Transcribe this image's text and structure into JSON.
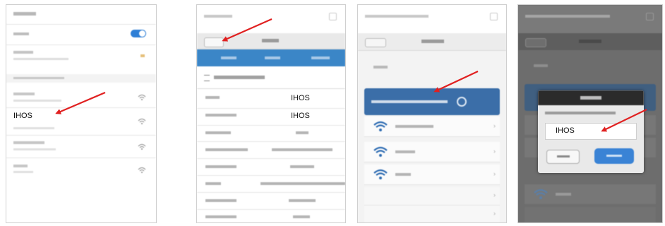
{
  "screen1": {
    "label": "IHOS"
  },
  "screen2": {
    "name_value": "IHOS",
    "device_name_value": "IHOS"
  },
  "screen4": {
    "input_value": "IHOS"
  },
  "colors": {
    "arrow": "#e02020",
    "accent_blue": "#3b86c7",
    "select_bar": "#3b6ea8",
    "ok_button": "#3a83d5"
  },
  "icons": [
    "wifi-icon",
    "lock-wifi-icon",
    "arrow-annotation-icon",
    "chevron-right-icon",
    "back-button-icon"
  ]
}
